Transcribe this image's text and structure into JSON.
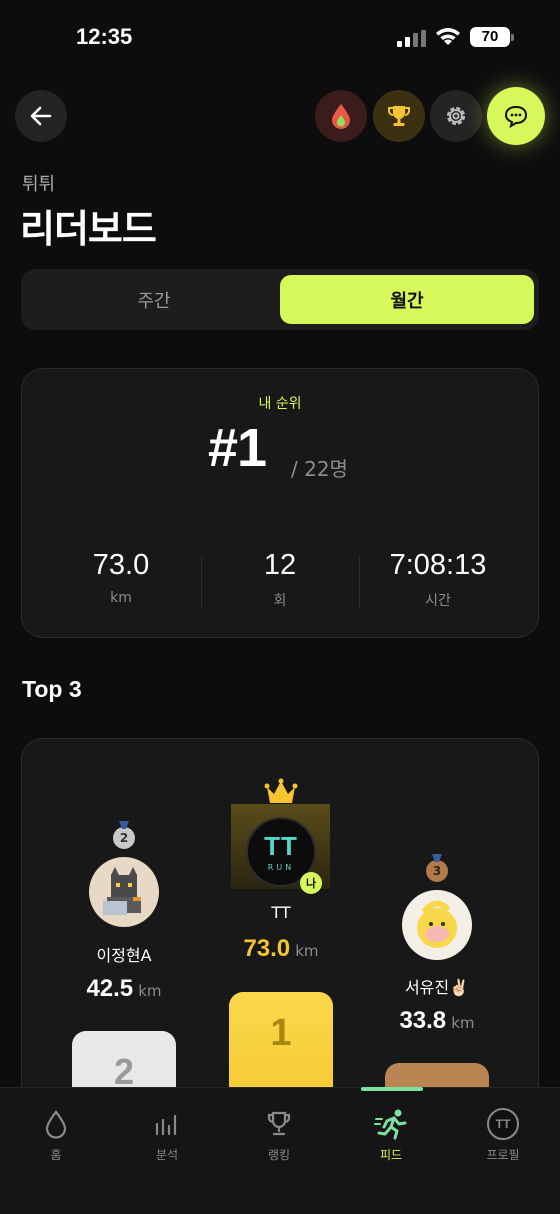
{
  "status_bar": {
    "time": "12:35",
    "battery": "70"
  },
  "header": {
    "subtitle": "튀튀",
    "title": "리더보드"
  },
  "period_tabs": [
    {
      "label": "주간"
    },
    {
      "label": "월간",
      "selected": true
    }
  ],
  "my_rank": {
    "label": "내 순위",
    "rank": "#1",
    "total": "/ 22명",
    "stats": [
      {
        "value": "73.0",
        "unit": "km"
      },
      {
        "value": "12",
        "unit": "회"
      },
      {
        "value": "7:08:13",
        "unit": "시간"
      }
    ]
  },
  "top3": {
    "title": "Top 3",
    "first": {
      "medal": "",
      "name": "TT",
      "distance": "73.0",
      "unit": "km",
      "me_badge": "나",
      "podium": "1",
      "avatar_text": "TT",
      "avatar_sub": "RUN"
    },
    "second": {
      "medal": "2",
      "name": "이정현A",
      "distance": "42.5",
      "unit": "km",
      "podium": "2"
    },
    "third": {
      "medal": "3",
      "name": "서유진✌🏻",
      "distance": "33.8",
      "unit": "km",
      "podium": ""
    }
  },
  "tabbar": [
    {
      "label": "홈",
      "icon": "drop-icon"
    },
    {
      "label": "분석",
      "icon": "bar-chart-icon"
    },
    {
      "label": "랭킹",
      "icon": "trophy-icon"
    },
    {
      "label": "피드",
      "icon": "runner-icon",
      "active": true
    },
    {
      "label": "프로필",
      "icon": "profile-tt-icon"
    }
  ],
  "colors": {
    "accent": "#d6f85a",
    "gold": "#f5c531",
    "background": "#0d0d0d"
  }
}
